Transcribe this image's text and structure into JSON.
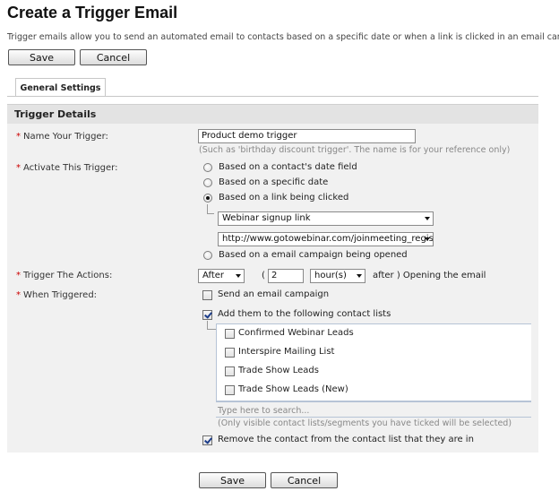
{
  "page": {
    "title": "Create a Trigger Email",
    "intro": "Trigger emails allow you to send an automated email to contacts based on a specific date or when a link is clicked in an email campaign."
  },
  "toolbar": {
    "save_label": "Save",
    "cancel_label": "Cancel"
  },
  "tabs": [
    {
      "label": "General Settings",
      "active": true
    }
  ],
  "section": {
    "title": "Trigger Details"
  },
  "fields": {
    "name": {
      "label": "Name Your Trigger:",
      "value": "Product demo trigger",
      "hint": "(Such as 'birthday discount trigger'. The name is for your reference only)"
    },
    "activate": {
      "label": "Activate This Trigger:",
      "options": [
        {
          "label": "Based on a contact's date field",
          "selected": false
        },
        {
          "label": "Based on a specific date",
          "selected": false
        },
        {
          "label": "Based on a link being clicked",
          "selected": true
        },
        {
          "label": "Based on a email campaign being opened",
          "selected": false
        }
      ],
      "campaign_select": "Webinar signup link",
      "link_select": "http://www.gotowebinar.com/joinmeeting_registration"
    },
    "actions": {
      "label": "Trigger The Actions:",
      "timing_select": "After",
      "open_paren": "(",
      "amount": "2",
      "unit_select": "hour(s)",
      "suffix": "after ) Opening the email"
    },
    "when": {
      "label": "When Triggered:",
      "send_campaign": {
        "label": "Send an email campaign",
        "checked": false
      },
      "add_lists": {
        "label": "Add them to the following contact lists",
        "checked": true
      },
      "lists": [
        {
          "label": "Confirmed Webinar Leads",
          "checked": false
        },
        {
          "label": "Interspire Mailing List",
          "checked": false
        },
        {
          "label": "Trade Show Leads",
          "checked": false
        },
        {
          "label": "Trade Show Leads (New)",
          "checked": false
        }
      ],
      "search_placeholder": "Type here to search...",
      "search_hint": "(Only visible contact lists/segments you have ticked will be selected)",
      "remove_contact": {
        "label": "Remove the contact from the contact list that they are in",
        "checked": true
      }
    }
  },
  "required_marker": "*",
  "colors": {
    "required": "#cc0000",
    "panel": "#f1f1f1",
    "panel_header": "#e3e3e3"
  }
}
